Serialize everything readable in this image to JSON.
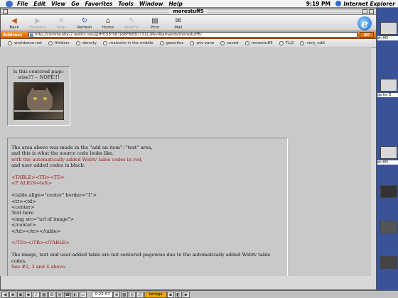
{
  "menubar": {
    "items": [
      "File",
      "Edit",
      "View",
      "Go",
      "Favorites",
      "Tools",
      "Window",
      "Help"
    ],
    "clock": "9:19 PM",
    "app_name": "Internet Explorer"
  },
  "window": {
    "title": "morestuff5"
  },
  "toolbar": {
    "buttons": [
      {
        "label": "Back",
        "icon": "back-arrow-icon",
        "enabled": true
      },
      {
        "label": "Forward",
        "icon": "forward-arrow-icon",
        "enabled": false
      },
      {
        "label": "Stop",
        "icon": "stop-icon",
        "enabled": false
      },
      {
        "label": "Refresh",
        "icon": "refresh-icon",
        "enabled": true
      },
      {
        "label": "Home",
        "icon": "home-icon",
        "enabled": true
      },
      {
        "label": "AutoFill",
        "icon": "autofill-icon",
        "enabled": false
      },
      {
        "label": "Print",
        "icon": "print-icon",
        "enabled": true
      },
      {
        "label": "Mail",
        "icon": "mail-icon",
        "enabled": true
      }
    ],
    "logo": "e"
  },
  "address": {
    "label": "Address",
    "url": "http://community-2.webtv.net/@HH!58!58!166F6B3D731C/Pevilliamands/morestuff5/",
    "go_label": "go"
  },
  "favorites": [
    "worldzone.net",
    "ffolders",
    "dencity",
    "malcolm in the middle",
    "geocities",
    "wtv-zone",
    "saved",
    "morestuff5",
    "TL/2",
    "very_odd"
  ],
  "content": {
    "box1_caption": "Is this centered page-wise?? -- NOPE!!!",
    "lines": [
      {
        "text": "The area above was made in the \"add an item\"--\"text\" area,",
        "red": false
      },
      {
        "text": "and this is what the source code looks like,",
        "red": false
      },
      {
        "text": "with the automatically added Webtv table codes in red,",
        "red": true
      },
      {
        "text": "and user added codes in black:",
        "red": false
      },
      {
        "text": "",
        "red": false
      },
      {
        "text": "<TABLE><TR><TD>",
        "red": true
      },
      {
        "text": "<P ALIGN=left>",
        "red": true
      },
      {
        "text": "",
        "red": false
      },
      {
        "text": "<table align=\"center\" border=\"1\">",
        "red": false
      },
      {
        "text": "<tr><td>",
        "red": false
      },
      {
        "text": "<center>",
        "red": false
      },
      {
        "text": "Text here",
        "red": false
      },
      {
        "text": "<img src=\"url of image\">",
        "red": false
      },
      {
        "text": "</center>",
        "red": false
      },
      {
        "text": "</td></tr></table>",
        "red": false
      },
      {
        "text": "",
        "red": false
      },
      {
        "text": "</TD></TR></TABLE>",
        "red": true
      },
      {
        "text": "",
        "red": false
      },
      {
        "text": "The image, text and user-added table are not centered pagewise due to the automatically added Webtv table codes.",
        "red": false
      },
      {
        "text": "See #2, 3 and 4 above.",
        "red": true
      }
    ]
  },
  "desktop": {
    "icons": [
      "sh HD",
      "ge for E",
      "sh HD"
    ]
  },
  "strip": {
    "clock": "0:22:07",
    "orange_label": "Iomega"
  },
  "colors": {
    "address_bar": "#e07818",
    "source_red": "#9a1010",
    "desktop": "#3a5298"
  }
}
